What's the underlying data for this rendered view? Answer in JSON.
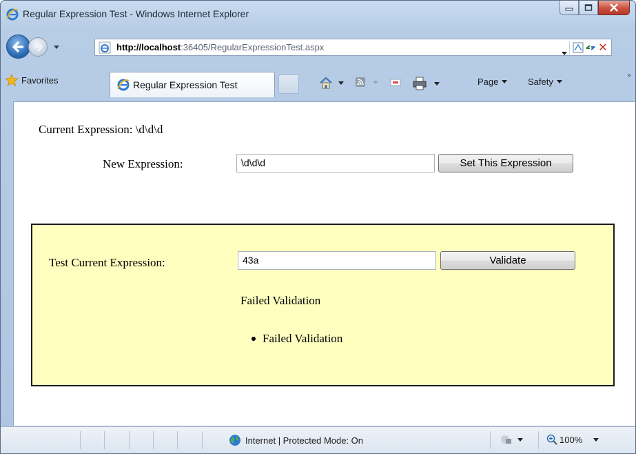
{
  "window": {
    "title": "Regular Expression Test - Windows Internet Explorer"
  },
  "address_bar": {
    "url_host": "http://localhost",
    "url_rest": ":36405/RegularExpressionTest.aspx"
  },
  "toolbar": {
    "favorites_label": "Favorites",
    "tab_label": "Regular Expression Test",
    "page_label": "Page",
    "safety_label": "Safety",
    "overflow_label": "»"
  },
  "page": {
    "current_expression_label": "Current Expression: \\d\\d\\d",
    "new_expression_label": "New Expression:",
    "new_expression_value": "\\d\\d\\d",
    "set_button_label": "Set This Expression",
    "test_label": "Test Current Expression:",
    "test_value": "43a",
    "validate_button_label": "Validate",
    "validation_message": "Failed Validation",
    "validation_summary": [
      "Failed Validation"
    ]
  },
  "statusbar": {
    "zone_text": "Internet | Protected Mode: On",
    "zoom_text": "100%"
  },
  "colors": {
    "panel_background": "#ffffc0",
    "close_button": "#c9513f",
    "chrome": "#b7cde6"
  },
  "icons": [
    "ie-logo-icon",
    "minimize-icon",
    "maximize-icon",
    "close-icon",
    "back-arrow-icon",
    "forward-arrow-icon",
    "dropdown-icon",
    "page-favicon-icon",
    "compatibility-view-icon",
    "refresh-icon",
    "stop-icon",
    "star-icon",
    "home-icon",
    "rss-feed-icon",
    "read-mail-icon",
    "print-icon",
    "globe-icon",
    "protected-mode-icon",
    "zoom-icon"
  ]
}
